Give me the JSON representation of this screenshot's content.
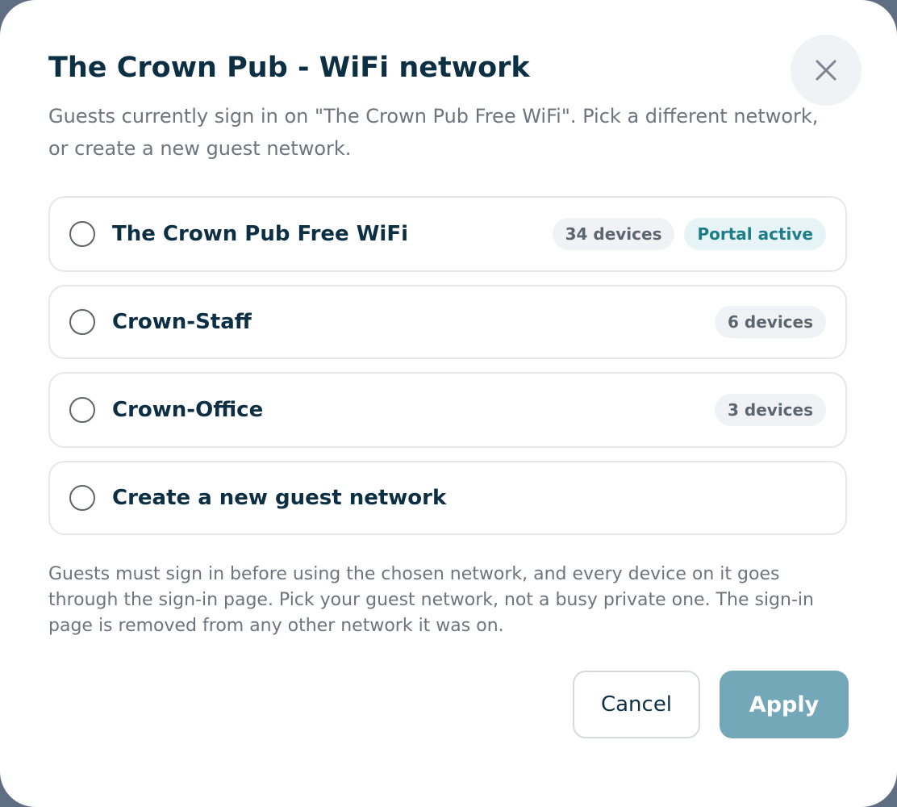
{
  "dialog": {
    "title": "The Crown Pub - WiFi network",
    "subtitle": "Guests currently sign in on \"The Crown Pub Free WiFi\". Pick a different network, or create a new guest network.",
    "close_icon": "close-icon",
    "note": "Guests must sign in before using the chosen network, and every device on it goes through the sign-in page. Pick your guest network, not a busy private one. The sign-in page is removed from any other network it was on.",
    "cancel_label": "Cancel",
    "apply_label": "Apply"
  },
  "options": [
    {
      "label": "The Crown Pub Free WiFi",
      "devices": "34 devices",
      "status": "Portal active",
      "selected": false
    },
    {
      "label": "Crown-Staff",
      "devices": "6 devices",
      "selected": false
    },
    {
      "label": "Crown-Office",
      "devices": "3 devices",
      "selected": false
    },
    {
      "label": "Create a new guest network",
      "selected": false
    }
  ],
  "colors": {
    "title": "#0d2f44",
    "body_text": "#6c757d",
    "apply_button": "#74a8b8",
    "portal_badge_bg": "#e6f4f7",
    "portal_badge_text": "#1e7d86",
    "device_badge_bg": "#f0f2f6"
  }
}
